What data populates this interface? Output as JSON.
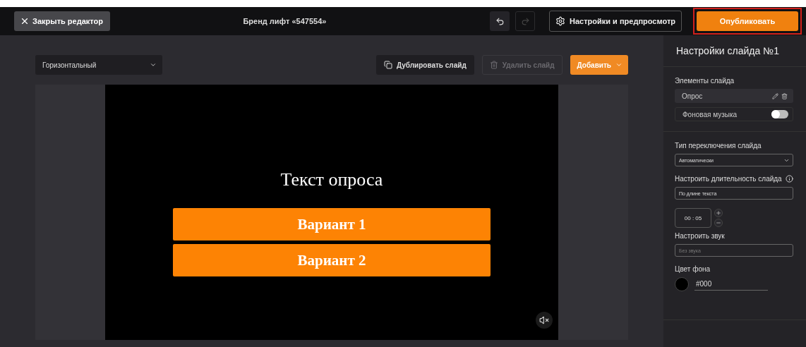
{
  "topbar": {
    "close_button": "Закрыть редактор",
    "title": "Бренд лифт «547554»",
    "undo": {
      "disabled": false
    },
    "redo": {
      "disabled": true
    },
    "settings_button": "Настройки и предпросмотр",
    "publish_button": {
      "label": "Опубликовать",
      "highlighted": true
    }
  },
  "toolbar": {
    "orientation": "Горизонтальный",
    "duplicate_button": {
      "label": "Дублировать слайд",
      "disabled": false
    },
    "delete_button": {
      "label": "Удалить слайд",
      "disabled": true
    },
    "add_button": "Добавить"
  },
  "slide": {
    "question": "Текст опроса",
    "options": [
      "Вариант 1",
      "Вариант 2"
    ],
    "muted": true
  },
  "panel": {
    "title": "Настройки слайда №1",
    "elements_label": "Элементы слайда",
    "elements": [
      {
        "kind": "item",
        "label": "Опрос"
      },
      {
        "kind": "toggle",
        "label": "Фоновая музыка",
        "on": false
      }
    ],
    "switch_type_label": "Тип переключения слайда",
    "switch_type": "Автоматически",
    "duration_label": "Настроить длительность слайда",
    "duration_mode": "По длине текста",
    "duration": "00 : 05",
    "sound_label": "Настроить звук",
    "sound_placeholder": "Без звука",
    "bg_label": "Цвет фона",
    "bg_value": "#000"
  }
}
